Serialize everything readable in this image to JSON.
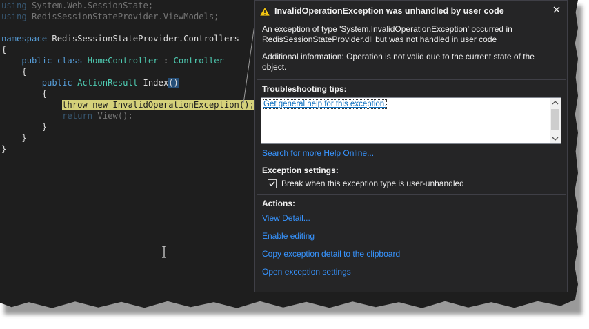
{
  "code": {
    "lines": [
      {
        "parts": [
          [
            "kw",
            "using"
          ],
          [
            "",
            " System.Web.SessionState;"
          ]
        ],
        "dim": true
      },
      {
        "parts": [
          [
            "kw",
            "using"
          ],
          [
            "",
            " RedisSessionStateProvider.ViewModels;"
          ]
        ],
        "dim": true
      },
      {
        "parts": [
          [
            "",
            ""
          ]
        ]
      },
      {
        "parts": [
          [
            "kw",
            "namespace"
          ],
          [
            "",
            " RedisSessionStateProvider.Controllers"
          ]
        ]
      },
      {
        "parts": [
          [
            "",
            "{"
          ]
        ]
      },
      {
        "parts": [
          [
            "",
            "    "
          ],
          [
            "kw",
            "public class"
          ],
          [
            "",
            " "
          ],
          [
            "ty",
            "HomeController"
          ],
          [
            "",
            " : "
          ],
          [
            "ty",
            "Controller"
          ]
        ]
      },
      {
        "parts": [
          [
            "",
            "    {"
          ]
        ]
      },
      {
        "parts": [
          [
            "",
            "        "
          ],
          [
            "kw",
            "public"
          ],
          [
            "",
            " "
          ],
          [
            "ty",
            "ActionResult"
          ],
          [
            "",
            " Index"
          ],
          [
            "brace",
            "()"
          ]
        ]
      },
      {
        "parts": [
          [
            "",
            "        {"
          ]
        ]
      },
      {
        "parts": [
          [
            "",
            "            "
          ],
          [
            "hl",
            "throw new InvalidOperationException();"
          ]
        ]
      },
      {
        "parts": [
          [
            "",
            "            "
          ],
          [
            "kwdim",
            "return"
          ],
          [
            "dim",
            " View();"
          ]
        ]
      },
      {
        "parts": [
          [
            "",
            "        }"
          ]
        ]
      },
      {
        "parts": [
          [
            "",
            "    }"
          ]
        ]
      },
      {
        "parts": [
          [
            "",
            "}"
          ]
        ]
      }
    ]
  },
  "dialog": {
    "icon": "warning-icon",
    "title": "InvalidOperationException was unhandled by user code",
    "close_icon": "close-icon",
    "message_1a": "An exception of type 'System.InvalidOperationException' occurred in",
    "message_1b": "RedisSessionStateProvider.dll but was not handled in user code",
    "message_2a": "Additional information: Operation is not valid due to the current state of the",
    "message_2b": "object.",
    "tips_heading": "Troubleshooting tips:",
    "tips_link": "Get general help for this exception.",
    "search_online": "Search for more Help Online...",
    "exception_settings_heading": "Exception settings:",
    "checkbox_label": "Break when this exception type is user-unhandled",
    "checkbox_checked": true,
    "actions_heading": "Actions:",
    "actions": [
      "View Detail...",
      "Enable editing",
      "Copy exception detail to the clipboard",
      "Open exception settings"
    ]
  }
}
